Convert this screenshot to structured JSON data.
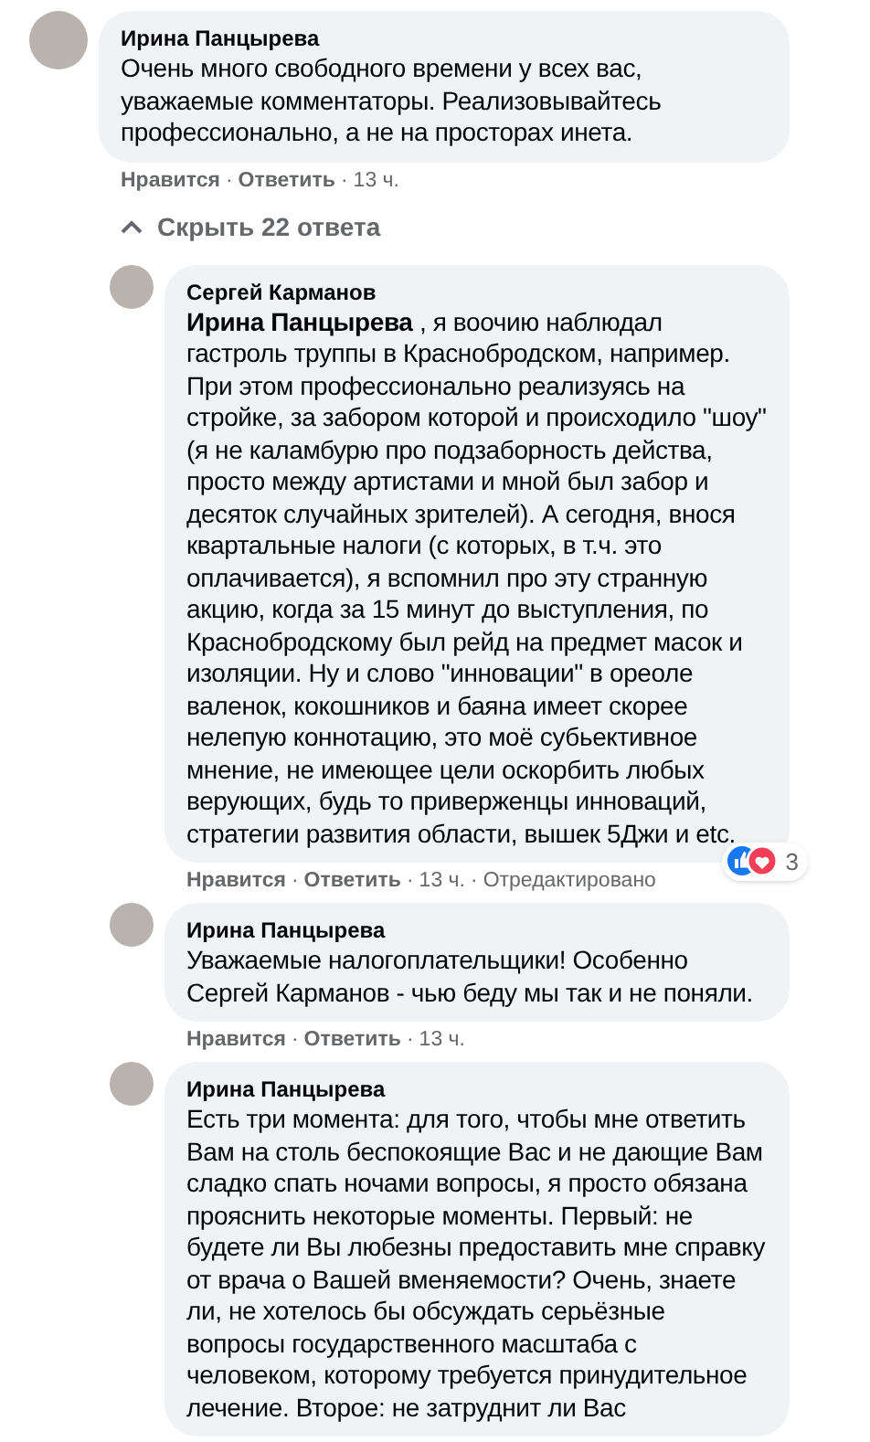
{
  "meta_separator": "·",
  "comment": {
    "author": "Ирина Панцырева",
    "text": "Очень много свободного времени у всех вас, уважаемые комментаторы. Реализовывайтесь профессионально, а не на просторах инета.",
    "actions": [
      "Нравится",
      "Ответить"
    ],
    "time": "13 ч."
  },
  "replies_toggle": {
    "label": "Скрыть 22 ответа",
    "expanded": true
  },
  "replies": [
    {
      "author": "Сергей Карманов",
      "text": "**Ирина Панцырева** , я воочию наблюдал гастроль труппы в Краснобродском, например. При этом профессионально реализуясь на стройке, за забором которой и происходило \"шоу\" (я не каламбурю про подзаборность действа, просто между артистами и мной был забор и десяток случайных зрителей). А сегодня, внося квартальные налоги (с которых, в т.ч. это оплачивается), я вспомнил про эту странную акцию, когда за 15 минут до выступления, по Краснобродскому был рейд на предмет масок и изоляции. Ну и слово \"инновации\" в ореоле валенок, кокошников и баяна имеет скорее нелепую коннотацию, это моё субьективное мнение, не имеющее цели оскорбить любых верующих, будь то приверженцы инноваций, стратегии развития области, вышек 5Джи и etc.",
      "actions": [
        "Нравится",
        "Ответить"
      ],
      "time": "13 ч.",
      "edited": "Отредактировано",
      "reactions": {
        "count": "3"
      }
    },
    {
      "author": "Ирина Панцырева",
      "text": "Уважаемые налогоплательщики! Особенно Сергей Карманов - чью беду мы так и не поняли.",
      "actions": [
        "Нравится",
        "Ответить"
      ],
      "time": "13 ч."
    },
    {
      "author": "Ирина Панцырева",
      "text": "Есть три момента: для того, чтобы мне ответить Вам на столь беспокоящие Вас и не дающие Вам сладко спать ночами вопросы, я просто обязана прояснить некоторые моменты. Первый: не будете ли Вы любезны предоставить мне справку от врача о Вашей вменяемости? Очень, знаете ли, не хотелось бы обсуждать серьёзные вопросы государственного масштаба с человеком, которому требуется принудительное лечение. Второе: не затруднит ли Вас"
    }
  ]
}
